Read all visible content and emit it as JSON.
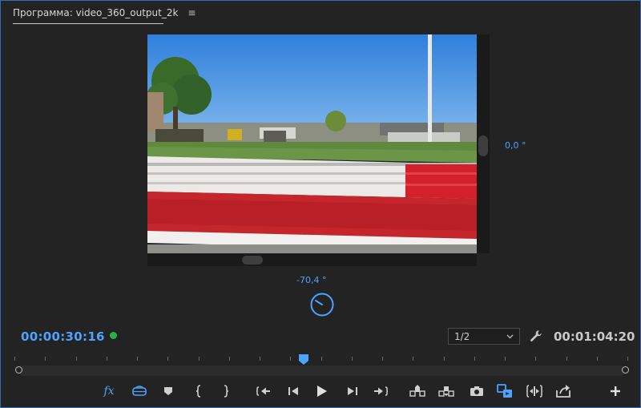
{
  "panel": {
    "title": "Программа: video_360_output_2k",
    "menu_glyph": "≡"
  },
  "viewer": {
    "horizontal_angle": "0,0 °",
    "vertical_angle": "-70,4 °"
  },
  "timecode": {
    "current": "00:00:30:16",
    "duration": "00:01:04:20"
  },
  "resolution": {
    "selected": "1/2"
  },
  "controls": {
    "fx_label": "fx"
  },
  "colors": {
    "accent": "#4da3ff",
    "status_ok": "#25b34a",
    "background": "#232323"
  },
  "playhead_fraction": 0.471
}
